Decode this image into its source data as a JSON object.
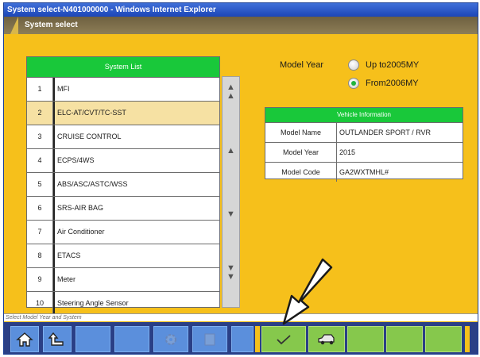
{
  "window": {
    "title": "System select-N401000000 - Windows Internet Explorer"
  },
  "header": {
    "title": "System select"
  },
  "system_list": {
    "title": "System List",
    "items": [
      {
        "num": "1",
        "name": "MFI"
      },
      {
        "num": "2",
        "name": "ELC-AT/CVT/TC-SST"
      },
      {
        "num": "3",
        "name": "CRUISE CONTROL"
      },
      {
        "num": "4",
        "name": "ECPS/4WS"
      },
      {
        "num": "5",
        "name": "ABS/ASC/ASTC/WSS"
      },
      {
        "num": "6",
        "name": "SRS-AIR BAG"
      },
      {
        "num": "7",
        "name": "Air Conditioner"
      },
      {
        "num": "8",
        "name": "ETACS"
      },
      {
        "num": "9",
        "name": "Meter"
      },
      {
        "num": "10",
        "name": "Steering Angle Sensor"
      }
    ],
    "selected_index": 1
  },
  "model_year": {
    "label": "Model Year",
    "options": [
      {
        "label": "Up to2005MY",
        "selected": false
      },
      {
        "label": "From2006MY",
        "selected": true
      }
    ]
  },
  "vehicle_info": {
    "title": "Vehicle Information",
    "rows": [
      {
        "key": "Model Name",
        "value": "OUTLANDER SPORT / RVR"
      },
      {
        "key": "Model Year",
        "value": "2015"
      },
      {
        "key": "Model Code",
        "value": "GA2WXTMHL#"
      }
    ]
  },
  "status": {
    "text": "Select Model Year and System"
  },
  "toolbar": {
    "buttons": [
      {
        "name": "home-icon"
      },
      {
        "name": "back-icon"
      },
      {
        "name": "blank"
      },
      {
        "name": "gear-icon"
      },
      {
        "name": "help-icon"
      },
      {
        "name": "checkmark-icon"
      },
      {
        "name": "car-icon"
      }
    ]
  },
  "colors": {
    "background": "#f6c01b",
    "header_green": "#19c83a",
    "toolbar": "#2a3f86",
    "button": "#5b8fdc",
    "active_button": "#86c84c"
  }
}
